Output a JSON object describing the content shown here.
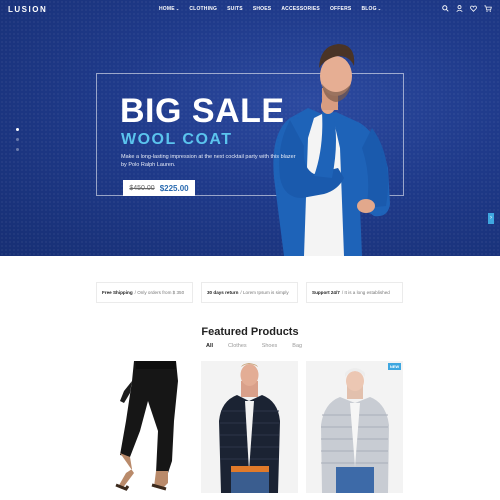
{
  "brand": {
    "logo": "LUSION"
  },
  "nav": {
    "items": [
      {
        "label": "HOME",
        "caret": "⌄"
      },
      {
        "label": "CLOTHING"
      },
      {
        "label": "SUITS"
      },
      {
        "label": "SHOES"
      },
      {
        "label": "ACCESSORIES"
      },
      {
        "label": "OFFERS"
      },
      {
        "label": "BLOG",
        "caret": "⌄"
      }
    ],
    "icons": [
      "search-icon",
      "user-icon",
      "heart-icon",
      "cart-icon"
    ]
  },
  "hero": {
    "title": "BIG SALE",
    "subtitle": "WOOL COAT",
    "description": "Make a long-lasting impression at the next cocktail party with this blazer by Polo Ralph Lauren.",
    "old_price": "$450.00",
    "new_price": "$225.00",
    "next_arrow": "›",
    "colors": {
      "background": "#1f3a8a",
      "accent": "#5bc4ee",
      "price": "#2b6bb0"
    }
  },
  "features": [
    {
      "title": "Free Shipping",
      "text": "/ Only orders from $ 350"
    },
    {
      "title": "30 days return",
      "text": "/ Lorem Ipsum is simply"
    },
    {
      "title": "Support 24/7",
      "text": "/ It is a long established"
    }
  ],
  "featured": {
    "title": "Featured Products",
    "tabs": [
      "All",
      "Clothes",
      "Shoes",
      "Bag"
    ],
    "new_badge": "NEW"
  }
}
